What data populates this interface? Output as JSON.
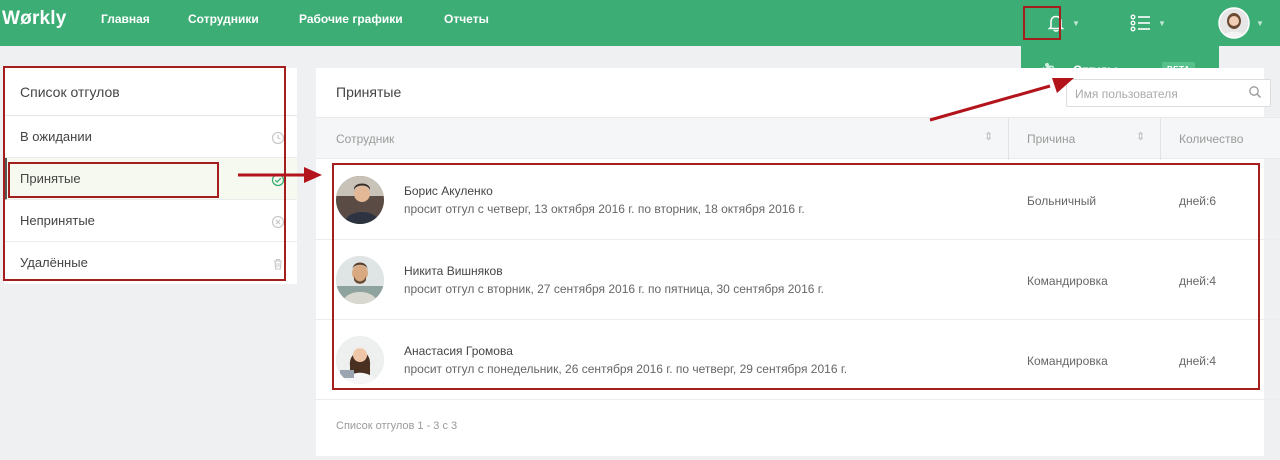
{
  "app": {
    "logo": "Wørkly"
  },
  "nav": [
    {
      "label": "Главная"
    },
    {
      "label": "Сотрудники"
    },
    {
      "label": "Рабочие графики"
    },
    {
      "label": "Отчеты"
    }
  ],
  "dropdown": {
    "label": "Отгулы",
    "badge": "BETA"
  },
  "sidebar": {
    "title": "Список отгулов",
    "items": [
      {
        "label": "В ожидании",
        "icon": "clock-icon"
      },
      {
        "label": "Принятые",
        "icon": "check-circle-icon"
      },
      {
        "label": "Непринятые",
        "icon": "x-circle-icon"
      },
      {
        "label": "Удалённые",
        "icon": "trash-icon"
      }
    ]
  },
  "main": {
    "title": "Принятые",
    "search_placeholder": "Имя пользователя",
    "columns": [
      "Сотрудник",
      "Причина",
      "Количество"
    ],
    "rows": [
      {
        "name": "Борис Акуленко",
        "desc": "просит отгул с четверг, 13 октября 2016 г. по вторник, 18 октября 2016 г.",
        "reason": "Больничный",
        "count": "дней:6"
      },
      {
        "name": "Никита Вишняков",
        "desc": "просит отгул с вторник, 27 сентября 2016 г. по пятница, 30 сентября 2016 г.",
        "reason": "Командировка",
        "count": "дней:4"
      },
      {
        "name": "Анастасия Громова",
        "desc": "просит отгул с понедельник, 26 сентября 2016 г. по четверг, 29 сентября 2016 г.",
        "reason": "Командировка",
        "count": "дней:4"
      }
    ],
    "footer": "Список отгулов 1 - 3 с 3"
  },
  "colors": {
    "brand": "#3cad75",
    "highlight": "#a51e1e"
  }
}
